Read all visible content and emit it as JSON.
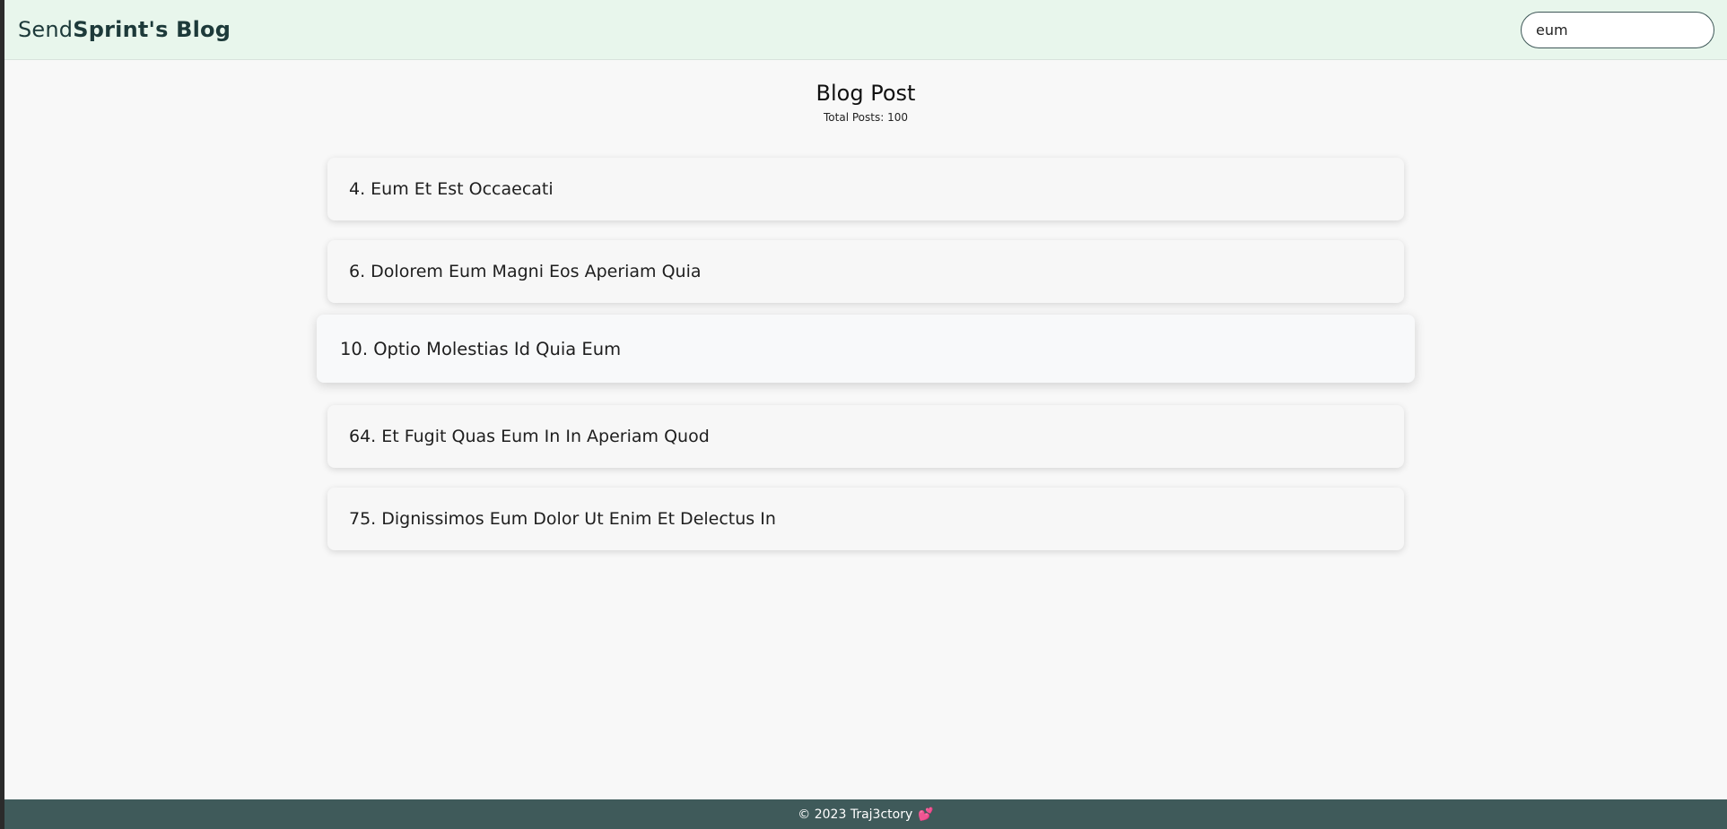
{
  "header": {
    "brand_send": "Send",
    "brand_sprint": "Sprint's Blog",
    "search_value": "eum"
  },
  "main": {
    "title": "Blog Post",
    "subtitle": "Total Posts: 100",
    "posts": [
      {
        "label": "4. Eum Et Est Occaecati"
      },
      {
        "label": "6. Dolorem Eum Magni Eos Aperiam Quia"
      },
      {
        "label": "10. Optio Molestias Id Quia Eum"
      },
      {
        "label": "64. Et Fugit Quas Eum In In Aperiam Quod"
      },
      {
        "label": "75. Dignissimos Eum Dolor Ut Enim Et Delectus In"
      }
    ]
  },
  "footer": {
    "text": "© 2023 Traj3ctory",
    "icon": "heart-icon",
    "icon_glyph": "💕"
  },
  "colors": {
    "header_bg": "#e8f6ec",
    "footer_bg": "#3f5a5a",
    "page_bg": "#f8f8f8"
  }
}
